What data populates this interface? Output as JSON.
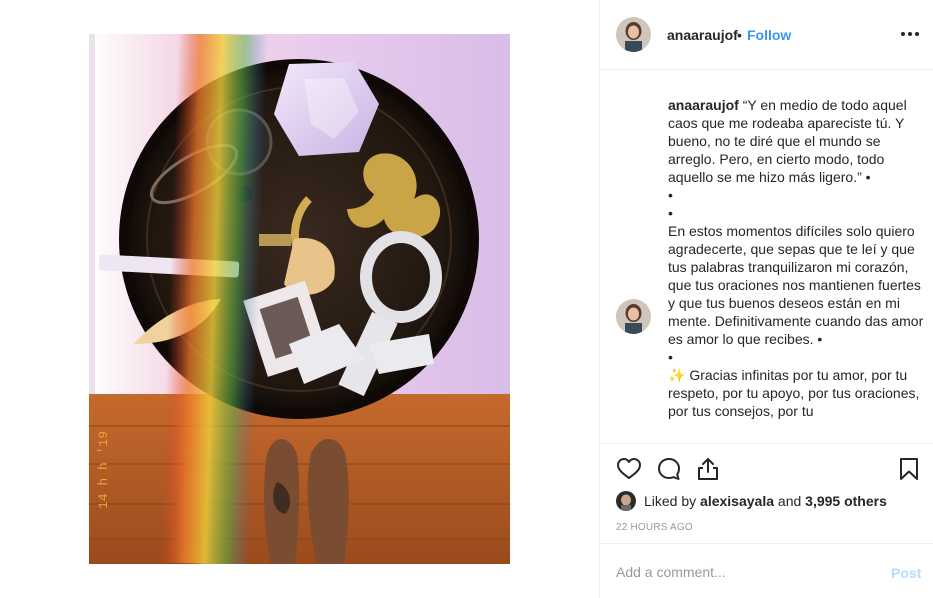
{
  "post": {
    "image_alt": "Wooden tray with crystal, om symbol, ankh, feather and small trinkets above bare feet on wooden floor",
    "photo_stamp": "14 h h '19"
  },
  "header": {
    "username": "anaaraujof",
    "separator": "•",
    "follow_label": "Follow",
    "more_icon": "more-horizontal-icon"
  },
  "caption": {
    "username": "anaaraujof",
    "lines": [
      " “Y en medio de todo aquel caos que me rodeaba apareciste tú. Y bueno, no te diré que el mundo se arreglo. Pero, en cierto modo, todo aquello se me hizo más ligero.” •",
      "•",
      "•",
      "En estos momentos difíciles solo quiero agradecerte, que sepas que te leí y que tus palabras tranquilizaron mi corazón, que tus oraciones nos mantienen fuertes y que tus buenos deseos están en mi mente. Definitivamente cuando das amor es amor lo que recibes. •",
      "•"
    ],
    "sparkle_icon": "✨",
    "last_line": " Gracias infinitas por tu amor, por tu respeto, por tu apoyo, por tus oraciones, por tus consejos, por tu"
  },
  "actions": {
    "icons": [
      "heart-icon",
      "comment-icon",
      "share-icon",
      "bookmark-icon"
    ],
    "liked_by_prefix": "Liked by ",
    "liked_by_user": "alexisayala",
    "liked_by_middle": " and ",
    "liked_by_count": "3,995 others",
    "timestamp": "22 HOURS AGO"
  },
  "comment": {
    "placeholder": "Add a comment...",
    "value": "",
    "post_label": "Post"
  },
  "colors": {
    "link": "#3897f0",
    "text": "#262626",
    "muted": "#999999",
    "post_disabled": "#b3dbff",
    "border": "#efefef"
  }
}
